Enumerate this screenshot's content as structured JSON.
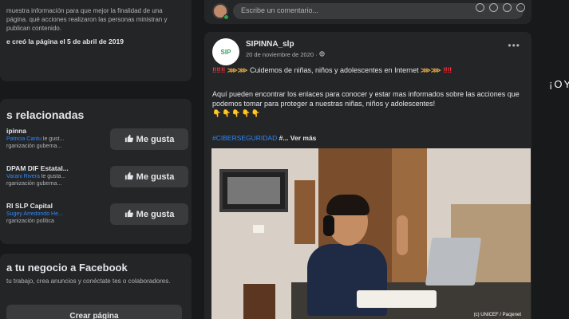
{
  "left": {
    "about": {
      "text": "muestra información para que mejor la finalidad de una página. qué acciones realizaron las personas ministran y publican contenido.",
      "created": "e creó la página el 5 de abril de 2019"
    },
    "related": {
      "title": "s relacionadas",
      "items": [
        {
          "name": "ipinna",
          "liker": "Patricia Cantu",
          "liked_suffix": " le gust...",
          "category": "rganización guberna...",
          "button": "Me gusta"
        },
        {
          "name": "DPAM DIF Estatal...",
          "liker": "Varani Rivera",
          "liked_suffix": " le gusta...",
          "category": "rganización guberna...",
          "button": "Me gusta"
        },
        {
          "name": "RI SLP Capital",
          "liker": "Sugey Arredondo He...",
          "liked_suffix": "",
          "category": "rganización política",
          "button": "Me gusta"
        }
      ]
    },
    "business": {
      "title": "a tu negocio a Facebook",
      "text": "tu trabajo, crea anuncios y conéctate tes o colaboradores.",
      "button": "Crear página"
    }
  },
  "comment": {
    "placeholder": "Escribe un comentario..."
  },
  "post": {
    "author": "SIPINNA_slp",
    "date": "20 de noviembre de 2020 · ",
    "avatar_text": "SIP",
    "line1_emojis_a": "‼‼‼",
    "line1_arrows_a": "⋙⋙",
    "line1_text": " Cuidemos de niñas, niños y adolescentes en Internet",
    "line1_arrows_b": "⋙⋙",
    "line1_emojis_b": "‼‼",
    "body": "Aquí pueden encontrar los enlaces para conocer y estar mas informados sobre las acciones que podemos tomar para proteger a nuestras niñas, niños y adolescentes!",
    "hands": "👇👇👇👇👇",
    "hashtag": "#CIBERSEGURIDAD",
    "more": " #... Ver más",
    "image_credit": "(c) UNICEF / Pacjenet"
  },
  "right": {
    "text": "¡OY"
  },
  "colors": {
    "background": "#18191a",
    "card": "#242526",
    "button": "#3a3b3c",
    "link": "#2d88ff"
  }
}
